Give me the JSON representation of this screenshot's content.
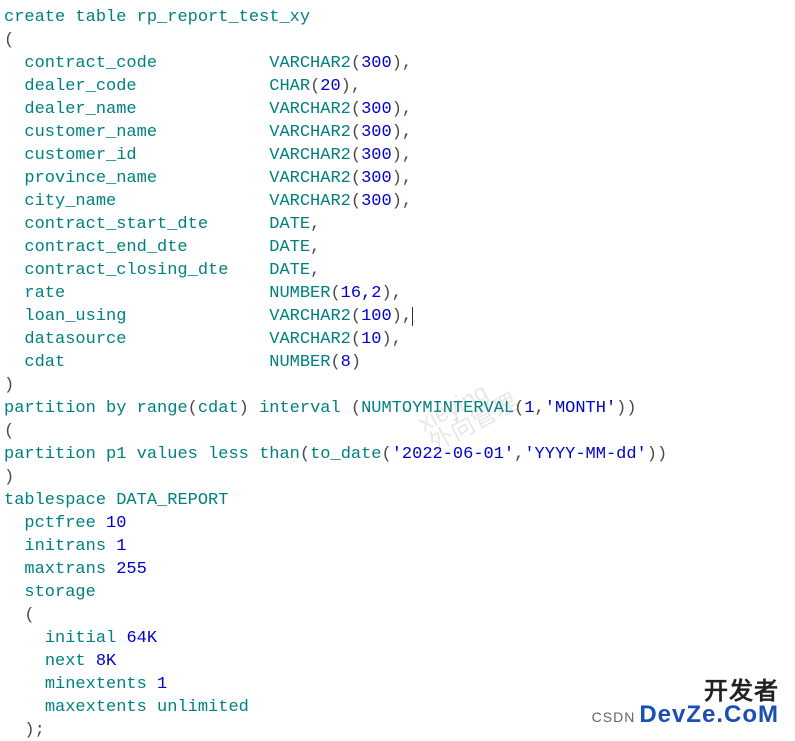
{
  "sql": {
    "create": "create",
    "table": "table",
    "table_name": "rp_report_test_xy",
    "lparen": "(",
    "rparen": ")",
    "comma": ",",
    "columns": [
      {
        "name": "contract_code",
        "type": "VARCHAR2",
        "args": "300"
      },
      {
        "name": "dealer_code",
        "type": "CHAR",
        "args": "20"
      },
      {
        "name": "dealer_name",
        "type": "VARCHAR2",
        "args": "300"
      },
      {
        "name": "customer_name",
        "type": "VARCHAR2",
        "args": "300"
      },
      {
        "name": "customer_id",
        "type": "VARCHAR2",
        "args": "300"
      },
      {
        "name": "province_name",
        "type": "VARCHAR2",
        "args": "300"
      },
      {
        "name": "city_name",
        "type": "VARCHAR2",
        "args": "300"
      },
      {
        "name": "contract_start_dte",
        "type": "DATE",
        "args": ""
      },
      {
        "name": "contract_end_dte",
        "type": "DATE",
        "args": ""
      },
      {
        "name": "contract_closing_dte",
        "type": "DATE",
        "args": ""
      },
      {
        "name": "rate",
        "type": "NUMBER",
        "args": "16,2"
      },
      {
        "name": "loan_using",
        "type": "VARCHAR2",
        "args": "100"
      },
      {
        "name": "datasource",
        "type": "VARCHAR2",
        "args": "10"
      },
      {
        "name": "cdat",
        "type": "NUMBER",
        "args": "8"
      }
    ],
    "partition_by": "partition",
    "by": "by",
    "range": "range",
    "range_col": "cdat",
    "interval": "interval",
    "interval_fn": "NUMTOYMINTERVAL",
    "interval_arg1": "1",
    "interval_arg2": "'MONTH'",
    "partition_kw": "partition",
    "partition_name": "p1",
    "values": "values",
    "less": "less",
    "than": "than",
    "to_date": "to_date",
    "to_date_arg1": "'2022-06-01'",
    "to_date_arg2": "'YYYY-MM-dd'",
    "tablespace": "tablespace",
    "tablespace_name": "DATA_REPORT",
    "pctfree": "pctfree",
    "pctfree_v": "10",
    "initrans": "initrans",
    "initrans_v": "1",
    "maxtrans": "maxtrans",
    "maxtrans_v": "255",
    "storage": "storage",
    "initial": "initial",
    "initial_v": "64K",
    "next": "next",
    "next_v": "8K",
    "minextents": "minextents",
    "minextents_v": "1",
    "maxextents": "maxextents",
    "maxextents_v": "unlimited",
    "semicolon": ";"
  },
  "watermark": {
    "text1": "xieying",
    "text2": "外向管理"
  },
  "logo": {
    "prefix": "CSDN",
    "line1": "开发者",
    "line2": "DevZe.CoM"
  }
}
